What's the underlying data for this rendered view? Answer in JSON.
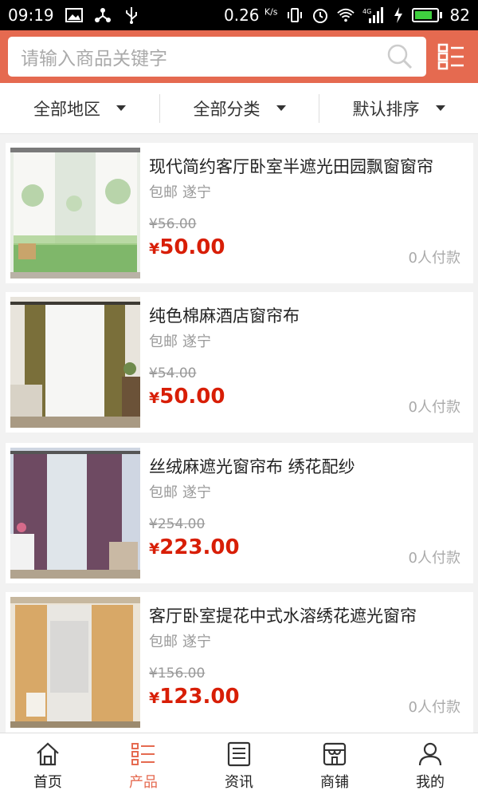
{
  "status_bar": {
    "time": "09:19",
    "network_speed": "0.26",
    "speed_unit": "K/s",
    "signal_label": "4G",
    "battery": "82",
    "battery_level": 0.82
  },
  "search": {
    "placeholder": "请输入商品关键字"
  },
  "filters": [
    {
      "label": "全部地区"
    },
    {
      "label": "全部分类"
    },
    {
      "label": "默认排序"
    }
  ],
  "products": [
    {
      "title": "现代简约客厅卧室半遮光田园飘窗窗帘",
      "shipping": "包邮",
      "city": "遂宁",
      "old_price": "¥56.00",
      "currency": "¥",
      "price": "50.00",
      "sold": "0人付款"
    },
    {
      "title": "纯色棉麻酒店窗帘布",
      "shipping": "包邮",
      "city": "遂宁",
      "old_price": "¥54.00",
      "currency": "¥",
      "price": "50.00",
      "sold": "0人付款"
    },
    {
      "title": "丝绒麻遮光窗帘布 绣花配纱",
      "shipping": "包邮",
      "city": "遂宁",
      "old_price": "¥254.00",
      "currency": "¥",
      "price": "223.00",
      "sold": "0人付款"
    },
    {
      "title": "客厅卧室提花中式水溶绣花遮光窗帘",
      "shipping": "包邮",
      "city": "遂宁",
      "old_price": "¥156.00",
      "currency": "¥",
      "price": "123.00",
      "sold": "0人付款"
    }
  ],
  "bottom_nav": [
    {
      "label": "首页",
      "icon": "home-icon"
    },
    {
      "label": "产品",
      "icon": "list-icon",
      "active": true
    },
    {
      "label": "资讯",
      "icon": "news-icon"
    },
    {
      "label": "商铺",
      "icon": "shop-icon"
    },
    {
      "label": "我的",
      "icon": "user-icon"
    }
  ],
  "colors": {
    "accent": "#e56a50",
    "price": "#d81e06"
  }
}
